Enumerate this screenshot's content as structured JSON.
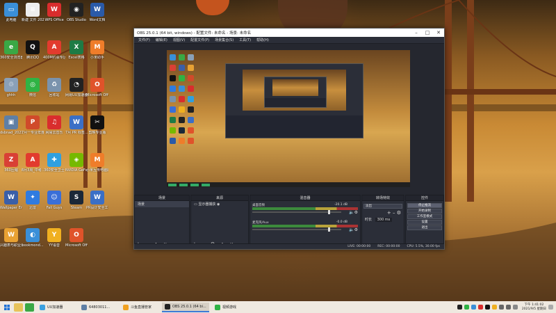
{
  "desktop": {
    "icons": [
      {
        "label": "此电脑",
        "icon": "computer-icon",
        "color": "#3a8fd8",
        "glyph": "▭"
      },
      {
        "label": "360安全浏览器",
        "icon": "browser-360-icon",
        "color": "#3aa845",
        "glyph": "e"
      },
      {
        "label": "ghhh",
        "icon": "recycle-bin-icon",
        "color": "#8aa0b8",
        "glyph": "♲"
      },
      {
        "label": "dsbnad_20210925...",
        "icon": "screenshot-file-icon",
        "color": "#5f7fa5",
        "glyph": "▣"
      },
      {
        "label": "360压缩",
        "icon": "archive-360-icon",
        "color": "#d94035",
        "glyph": "Z"
      },
      {
        "label": "Wallpaper Engine...",
        "icon": "wallpaper-engine-icon",
        "color": "#3b5fa8",
        "glyph": "W"
      },
      {
        "label": "兴趣表与职业计划...",
        "icon": "word-doc-icon",
        "color": "#e8a133",
        "glyph": "W"
      },
      {
        "label": "新建 文件 2021-09...",
        "icon": "text-file-icon",
        "color": "#eee",
        "glyph": "≡"
      },
      {
        "label": "腾讯QQ",
        "icon": "qq-icon",
        "color": "#111",
        "glyph": "Q"
      },
      {
        "label": "微信",
        "icon": "wechat-icon",
        "color": "#2fb344",
        "glyph": "◎"
      },
      {
        "label": "7月一专业年度工作总结...",
        "icon": "ppt-icon",
        "color": "#d04a2a",
        "glyph": "P"
      },
      {
        "label": "8月3周_中考...",
        "icon": "pdf-icon",
        "color": "#e23b2e",
        "glyph": "A"
      },
      {
        "label": "迅雷",
        "icon": "thunder-icon",
        "color": "#2f7be0",
        "glyph": "✦"
      },
      {
        "label": "bookmond...",
        "icon": "bookmark-icon",
        "color": "#3a8fd8",
        "glyph": "◐"
      },
      {
        "label": "WPS Office",
        "icon": "wps-icon",
        "color": "#d92d2d",
        "glyph": "W"
      },
      {
        "label": "400M约会专区网...",
        "icon": "pdf2-icon",
        "color": "#e23b2e",
        "glyph": "A"
      },
      {
        "label": "回收站",
        "icon": "trash-icon",
        "color": "#7a93ad",
        "glyph": "♻"
      },
      {
        "label": "网易云音乐",
        "icon": "netease-music-icon",
        "color": "#d92d2d",
        "glyph": "♫"
      },
      {
        "label": "360安全卫士",
        "icon": "security-360-icon",
        "color": "#2fa0e0",
        "glyph": "✚"
      },
      {
        "label": "Fall Guys",
        "icon": "fall-guys-icon",
        "color": "#3a6fd8",
        "glyph": "☺"
      },
      {
        "label": "YY语音",
        "icon": "yy-icon",
        "color": "#f0b020",
        "glyph": "Y"
      },
      {
        "label": "OBS Studio",
        "icon": "obs-icon",
        "color": "#222",
        "glyph": "◉"
      },
      {
        "label": "Excel表格",
        "icon": "excel-icon",
        "color": "#1e7b45",
        "glyph": "X"
      },
      {
        "label": "网易UU加速器",
        "icon": "uu-icon",
        "color": "#222",
        "glyph": "◔"
      },
      {
        "label": "7月 PR 标签...",
        "icon": "word2-icon",
        "color": "#3b6fc6",
        "glyph": "W"
      },
      {
        "label": "NVIDIA GeForce...",
        "icon": "nvidia-icon",
        "color": "#76b900",
        "glyph": "◈"
      },
      {
        "label": "Steam",
        "icon": "steam-icon",
        "color": "#1b2838",
        "glyph": "S"
      },
      {
        "label": "Microsoft Office...",
        "icon": "office-icon",
        "color": "#e0532a",
        "glyph": "O"
      },
      {
        "label": "Word文档",
        "icon": "word-icon",
        "color": "#2a5aa8",
        "glyph": "W"
      },
      {
        "label": "小米助手",
        "icon": "mi-icon",
        "color": "#ef7d2a",
        "glyph": "M"
      },
      {
        "label": "Microsoft Office...",
        "icon": "office2-icon",
        "color": "#e0532a",
        "glyph": "O"
      },
      {
        "label": "剪映专业版",
        "icon": "capcut-icon",
        "color": "#111",
        "glyph": "✂"
      },
      {
        "label": "小米互传电脑版",
        "icon": "mi-share-icon",
        "color": "#ef7d2a",
        "glyph": "M"
      },
      {
        "label": "PR设计安全工作...",
        "icon": "doc-icon",
        "color": "#3b6fc6",
        "glyph": "W"
      }
    ]
  },
  "obs": {
    "title": "OBS 25.0.1 (64 bit, windows) - 配置文件: 未命名 - 场景: 未命名",
    "menu": [
      "文件(F)",
      "编辑(E)",
      "视图(V)",
      "配置文件(P)",
      "场景集合(S)",
      "工具(T)",
      "帮助(H)"
    ],
    "docks": {
      "scenes": {
        "title": "场景",
        "items": [
          "场景"
        ]
      },
      "sources": {
        "title": "来源",
        "items": [
          "显示器捕获"
        ]
      },
      "mixer": {
        "title": "混音器",
        "channels": [
          {
            "name": "桌面音频",
            "db": "-20.1 dB"
          },
          {
            "name": "麦克风/Aux",
            "db": "-0.0 dB"
          }
        ]
      },
      "transitions": {
        "title": "转场特效",
        "type": "淡出",
        "duration_label": "时长",
        "duration": "300 ms"
      },
      "controls": {
        "title": "控件",
        "buttons": [
          "停止推流",
          "开始录制",
          "工作室模式",
          "设置",
          "退出"
        ]
      }
    },
    "status": {
      "live": "LIVE: 00:00:00",
      "rec": "REC: 00:00:00",
      "cpu": "CPU: 5.5%, 30.00 fps"
    }
  },
  "taskbar": {
    "apps": [
      {
        "label": "UU加速器",
        "color": "#3aa0e0",
        "active": false
      },
      {
        "label": "64803011...",
        "color": "#5f7fa5",
        "active": false
      },
      {
        "label": "斗鱼直播管家",
        "color": "#f0a020",
        "active": false
      },
      {
        "label": "OBS 25.0.1 (64 bi...",
        "color": "#222",
        "active": true
      },
      {
        "label": "视频游戏",
        "color": "#2fb344",
        "active": false
      }
    ],
    "time": "下午 1:41:02",
    "date": "2021/9/5 星期日"
  }
}
